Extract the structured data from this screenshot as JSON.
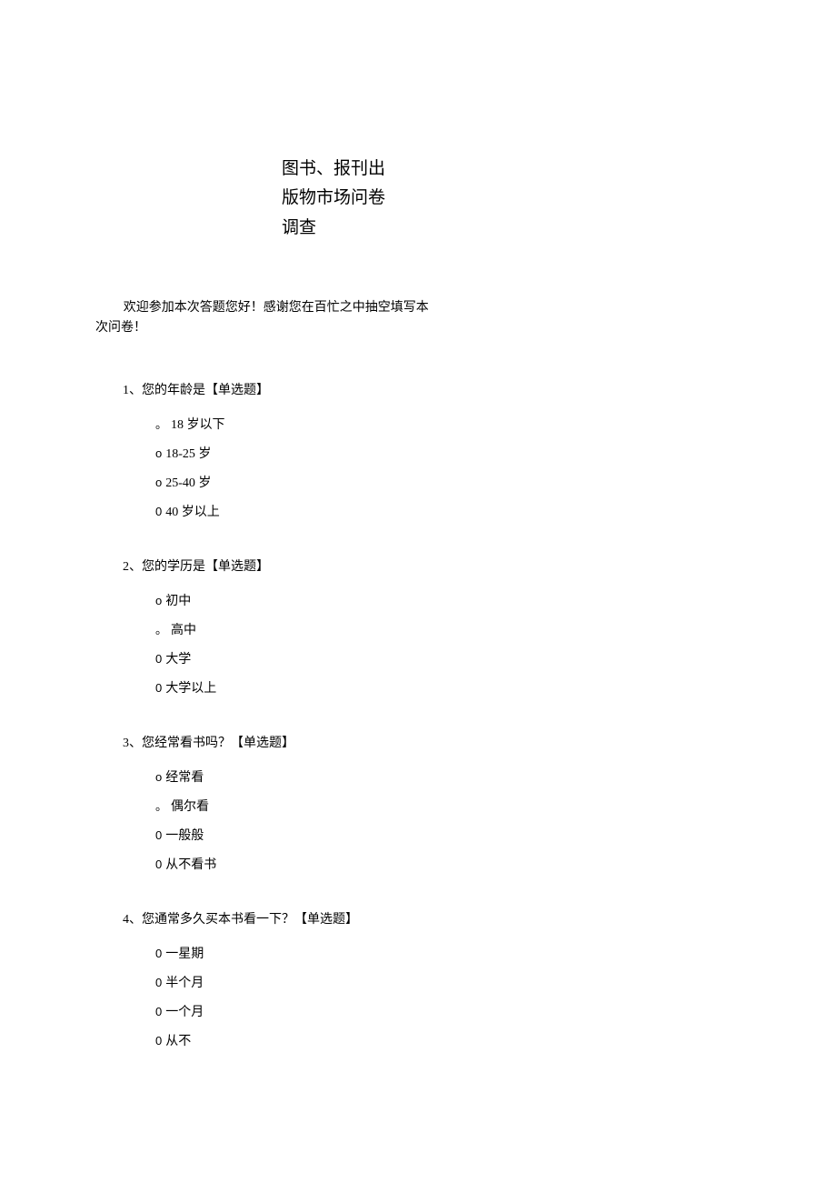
{
  "title": {
    "line1": "图书、报刊出",
    "line2": "版物市场问卷",
    "line3": "调查"
  },
  "intro": {
    "line1": "欢迎参加本次答题您好！感谢您在百忙之中抽空填写本",
    "line2": "次问卷！"
  },
  "questions": [
    {
      "number": "1、",
      "text": "您的年龄是【单选题】",
      "options": [
        {
          "bullet": "。",
          "text": "18 岁以下"
        },
        {
          "bullet": "o",
          "text": "18-25 岁"
        },
        {
          "bullet": "o",
          "text": "25-40 岁"
        },
        {
          "bullet": "0",
          "text": "40 岁以上"
        }
      ]
    },
    {
      "number": "2、",
      "text": "您的学历是【单选题】",
      "options": [
        {
          "bullet": "o",
          "text": " 初中"
        },
        {
          "bullet": "。",
          "text": "高中"
        },
        {
          "bullet": "0",
          "text": " 大学"
        },
        {
          "bullet": "0",
          "text": " 大学以上"
        }
      ]
    },
    {
      "number": "3、",
      "text": "您经常看书吗？【单选题】",
      "options": [
        {
          "bullet": "o",
          "text": " 经常看"
        },
        {
          "bullet": "。",
          "text": "偶尔看"
        },
        {
          "bullet": "0",
          "text": " 一般般"
        },
        {
          "bullet": "0",
          "text": " 从不看书"
        }
      ]
    },
    {
      "number": "4、",
      "text": "您通常多久买本书看一下？【单选题】",
      "options": [
        {
          "bullet": "0",
          "text": " 一星期"
        },
        {
          "bullet": "0",
          "text": " 半个月"
        },
        {
          "bullet": "0",
          "text": " 一个月"
        },
        {
          "bullet": "0",
          "text": " 从不"
        }
      ]
    }
  ]
}
